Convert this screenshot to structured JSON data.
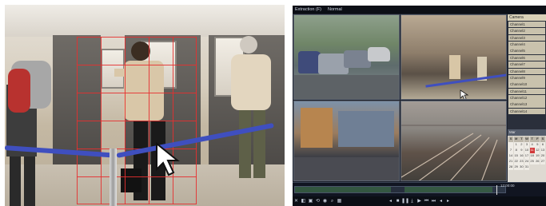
{
  "nvr": {
    "title_left": "Extraction (F)",
    "title_mode": "Normal",
    "side_panel": {
      "header": "Camera",
      "channels": [
        "Channel1",
        "Channel2",
        "Channel3",
        "Channel4",
        "Channel5",
        "Channel6",
        "Channel7",
        "Channel8",
        "Channel9",
        "Channel10",
        "Channel11",
        "Channel12",
        "Channel13",
        "Channel14"
      ]
    },
    "calendar": {
      "header": "Mar",
      "weekdays": [
        "S",
        "M",
        "T",
        "W",
        "T",
        "F",
        "S"
      ],
      "days": [
        "",
        "1",
        "2",
        "3",
        "4",
        "5",
        "6",
        "7",
        "8",
        "9",
        "10",
        "11",
        "12",
        "13",
        "14",
        "15",
        "16",
        "17",
        "18",
        "19",
        "20",
        "21",
        "22",
        "23",
        "24",
        "25",
        "26",
        "27",
        "28",
        "29",
        "30",
        "31"
      ],
      "highlighted_day": "11"
    },
    "timeline": {
      "time_label": "12:00:00"
    },
    "controls": [
      "✕",
      "◧",
      "▣",
      "⟲",
      "◉",
      "⌕",
      "▦",
      "◂",
      "■",
      "❚❚",
      "⤓",
      "▶",
      "⏮",
      "⏭",
      "◂",
      "▸"
    ]
  },
  "colors": {
    "grid_red": "#e53030",
    "rope_blue": "#3f4fbf",
    "nvr_bg": "#1b1f2a",
    "highlight_red": "#d23a3a"
  }
}
